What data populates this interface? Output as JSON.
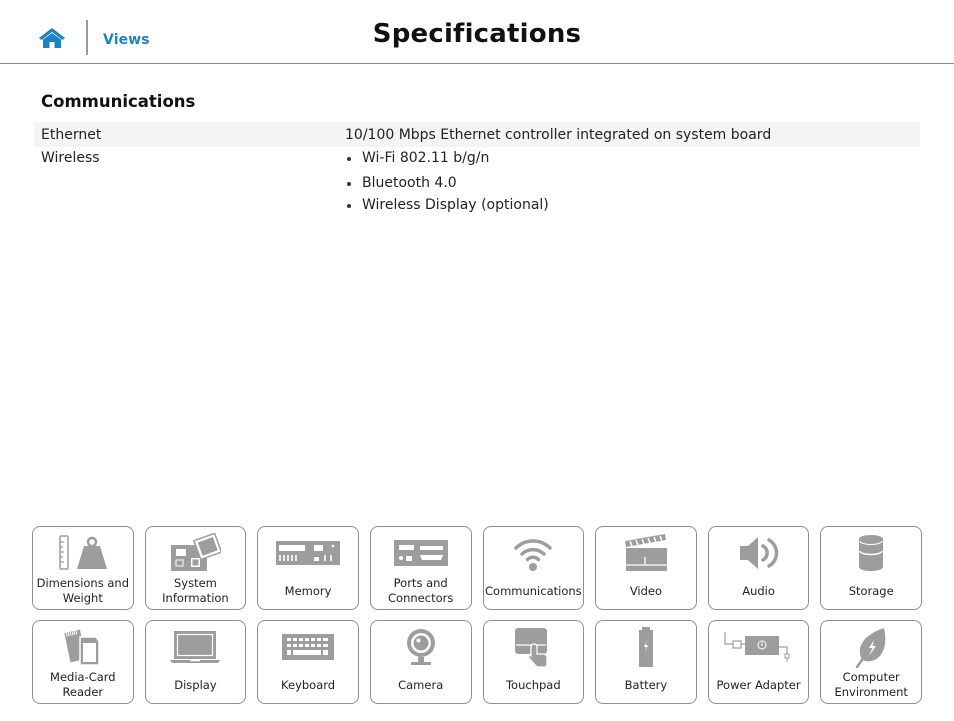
{
  "header": {
    "home_icon": "home-icon",
    "views_label": "Views",
    "title": "Specifications"
  },
  "colors": {
    "accent": "#1a84c7",
    "icon_gray": "#9d9d9d",
    "tile_border": "#8f8f8f",
    "row_shade": "#f4f4f4"
  },
  "section": {
    "title": "Communications",
    "rows": [
      {
        "label": "Ethernet",
        "value": "10/100 Mbps Ethernet controller integrated on system board"
      },
      {
        "label": "Wireless",
        "items": [
          "Wi-Fi 802.11 b/g/n",
          "Bluetooth 4.0",
          "Wireless Display (optional)"
        ]
      }
    ]
  },
  "tiles": [
    {
      "label": "Dimensions and Weight",
      "icon": "weight-ruler-icon"
    },
    {
      "label": "System Information",
      "icon": "system-board-icon"
    },
    {
      "label": "Memory",
      "icon": "memory-module-icon"
    },
    {
      "label": "Ports and Connectors",
      "icon": "ports-icon"
    },
    {
      "label": "Communications",
      "icon": "wifi-icon"
    },
    {
      "label": "Video",
      "icon": "clapperboard-icon"
    },
    {
      "label": "Audio",
      "icon": "speaker-icon"
    },
    {
      "label": "Storage",
      "icon": "storage-cylinder-icon"
    },
    {
      "label": "Media-Card Reader",
      "icon": "media-card-icon"
    },
    {
      "label": "Display",
      "icon": "laptop-display-icon"
    },
    {
      "label": "Keyboard",
      "icon": "keyboard-icon"
    },
    {
      "label": "Camera",
      "icon": "webcam-icon"
    },
    {
      "label": "Touchpad",
      "icon": "touchpad-icon"
    },
    {
      "label": "Battery",
      "icon": "battery-icon"
    },
    {
      "label": "Power Adapter",
      "icon": "power-adapter-icon"
    },
    {
      "label": "Computer Environment",
      "icon": "leaf-icon"
    }
  ]
}
